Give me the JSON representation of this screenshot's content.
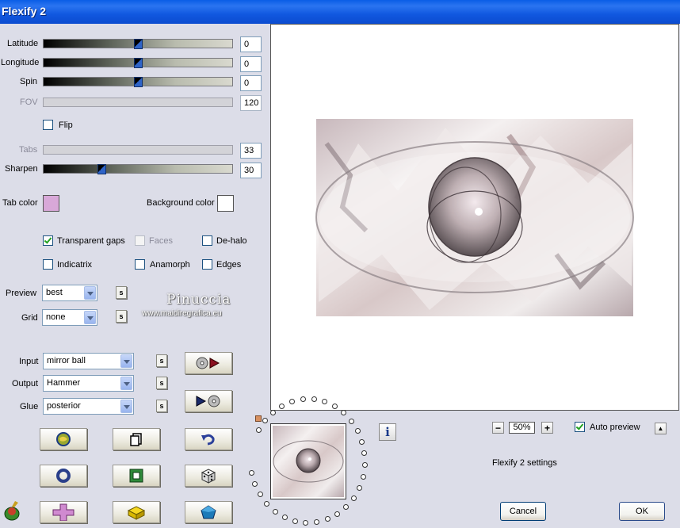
{
  "window": {
    "title": "Flexify 2"
  },
  "params": {
    "latitude": {
      "label": "Latitude",
      "value": "0"
    },
    "longitude": {
      "label": "Longitude",
      "value": "0"
    },
    "spin": {
      "label": "Spin",
      "value": "0"
    },
    "fov": {
      "label": "FOV",
      "value": "120"
    },
    "flip": {
      "label": "Flip",
      "checked": false
    },
    "tabs": {
      "label": "Tabs",
      "value": "33"
    },
    "sharpen": {
      "label": "Sharpen",
      "value": "30"
    }
  },
  "colors": {
    "tab_color_label": "Tab color",
    "tab_color": "#d8a8d8",
    "background_color_label": "Background color",
    "background_color": "#ffffff"
  },
  "options": {
    "transparent_gaps": {
      "label": "Transparent gaps",
      "checked": true
    },
    "faces": {
      "label": "Faces",
      "checked": false,
      "disabled": true
    },
    "de_halo": {
      "label": "De-halo",
      "checked": false
    },
    "indicatrix": {
      "label": "Indicatrix",
      "checked": false
    },
    "anamorph": {
      "label": "Anamorph",
      "checked": false
    },
    "edges": {
      "label": "Edges",
      "checked": false
    }
  },
  "preview_mode": {
    "label": "Preview",
    "value": "best"
  },
  "grid": {
    "label": "Grid",
    "value": "none"
  },
  "watermark": {
    "name": "Pinuccia",
    "url": "www.maidiregrafica.eu"
  },
  "projection": {
    "input": {
      "label": "Input",
      "value": "mirror ball"
    },
    "output": {
      "label": "Output",
      "value": "Hammer"
    },
    "glue": {
      "label": "Glue",
      "value": "posterior"
    }
  },
  "s_button_label": "s",
  "zoom": {
    "value": "50%",
    "minus": "−",
    "plus": "+"
  },
  "auto_preview": {
    "label": "Auto preview",
    "checked": true
  },
  "settings_text": "Flexify 2 settings",
  "buttons": {
    "cancel": "Cancel",
    "ok": "OK"
  },
  "info_icon_text": "i",
  "up_arrow_text": "▲",
  "accent": "#0a5ee6"
}
